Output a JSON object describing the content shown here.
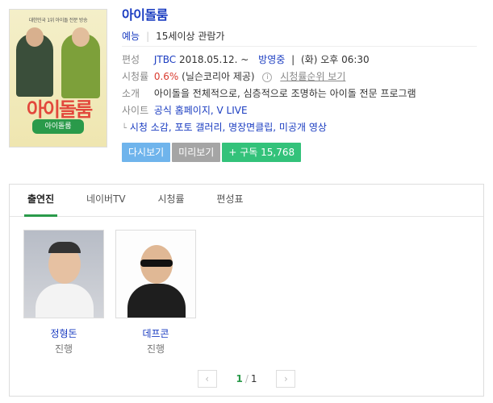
{
  "poster": {
    "header_text": "대한민국 1위 아이돌 전문 방송",
    "title_text": "아이돌룸",
    "sub_text": "아이돌룸"
  },
  "program": {
    "title": "아이돌룸",
    "genre": "예능",
    "rating": "15세이상 관람가",
    "schedule": {
      "label": "편성",
      "network": "JTBC",
      "date": "2018.05.12. ~",
      "status": "방영중",
      "time": "(화) 오후 06:30"
    },
    "viewership": {
      "label": "시청률",
      "value": "0.6%",
      "source": "(닐슨코리아 제공)",
      "info_glyph": "i",
      "rank_link": "시청률순위 보기"
    },
    "intro": {
      "label": "소개",
      "text": "아이돌을 전체적으로, 심층적으로 조명하는 아이돌 전문 프로그램"
    },
    "sites": {
      "label": "사이트",
      "links": [
        "공식 홈페이지",
        "V LIVE"
      ]
    },
    "related": {
      "arrow": "└",
      "text": "시청 소감, 포토 갤러리, 명장면클립, 미공개 영상"
    }
  },
  "actions": {
    "replay": "다시보기",
    "preview": "미리보기",
    "subscribe": "+ 구독 15,768"
  },
  "tabs": [
    "출연진",
    "네이버TV",
    "시청률",
    "편성표"
  ],
  "cast": [
    {
      "name": "정형돈",
      "role": "진행"
    },
    {
      "name": "데프콘",
      "role": "진행"
    }
  ],
  "pager": {
    "current": "1",
    "divider": "/",
    "total": "1",
    "prev": "‹",
    "next": "›"
  },
  "colors": {
    "link": "#1a3cc1",
    "accent_green": "#2a9a4a",
    "rating_red": "#d93a2e"
  }
}
